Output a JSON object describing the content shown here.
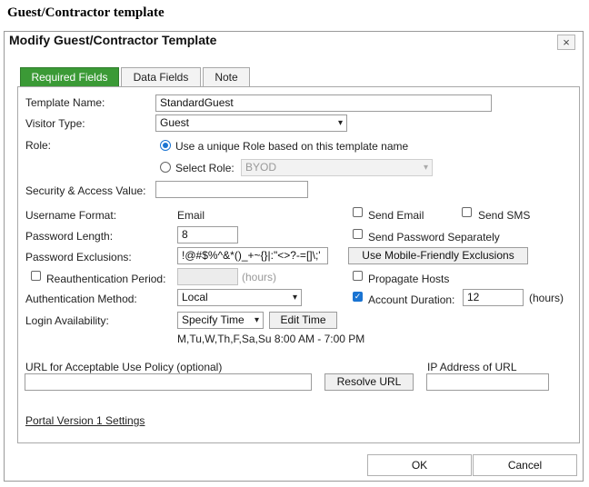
{
  "heading": "Guest/Contractor template",
  "dialog": {
    "title": "Modify Guest/Contractor Template",
    "close_glyph": "×"
  },
  "tabs": [
    {
      "label": "Required Fields",
      "active": true
    },
    {
      "label": "Data Fields",
      "active": false
    },
    {
      "label": "Note",
      "active": false
    }
  ],
  "fields": {
    "template_name": {
      "label": "Template Name:",
      "value": "StandardGuest"
    },
    "visitor_type": {
      "label": "Visitor Type:",
      "value": "Guest"
    },
    "role": {
      "label": "Role:",
      "option_unique": "Use a unique Role based on this template name",
      "option_select": "Select Role:",
      "select_value": "BYOD",
      "selected": "unique"
    },
    "security_access": {
      "label": "Security & Access Value:",
      "value": ""
    },
    "username_format": {
      "label": "Username Format:",
      "value": "Email"
    },
    "password_length": {
      "label": "Password Length:",
      "value": "8"
    },
    "password_exclusions": {
      "label": "Password Exclusions:",
      "value": "!@#$%^&*()_+~{}|:\"<>?-=[]\\;'"
    },
    "reauth_period": {
      "label": "Reauthentication Period:",
      "value": "",
      "unit": "(hours)",
      "checked": false
    },
    "auth_method": {
      "label": "Authentication Method:",
      "value": "Local"
    },
    "login_availability": {
      "label": "Login Availability:",
      "value": "Specify Time",
      "edit_button": "Edit Time",
      "schedule": "M,Tu,W,Th,F,Sa,Su 8:00 AM - 7:00 PM"
    },
    "send_email": {
      "label": "Send Email",
      "checked": false
    },
    "send_sms": {
      "label": "Send SMS",
      "checked": false
    },
    "send_password_separately": {
      "label": "Send Password Separately",
      "checked": false
    },
    "mobile_exclusions_button": "Use Mobile-Friendly Exclusions",
    "propagate_hosts": {
      "label": "Propagate Hosts",
      "checked": false
    },
    "account_duration": {
      "label": "Account Duration:",
      "value": "12",
      "unit": "(hours)",
      "checked": true
    },
    "aup_url": {
      "label": "URL for Acceptable Use Policy (optional)",
      "value": ""
    },
    "resolve_button": "Resolve URL",
    "ip_address": {
      "label": "IP Address of URL",
      "value": ""
    },
    "portal_link": "Portal Version 1 Settings"
  },
  "footer": {
    "ok": "OK",
    "cancel": "Cancel"
  },
  "colors": {
    "tab_active": "#3b9a36",
    "checkbox_checked": "#1a74d2"
  },
  "icons": {
    "checkmark": "✓",
    "dropdown": "▾"
  }
}
